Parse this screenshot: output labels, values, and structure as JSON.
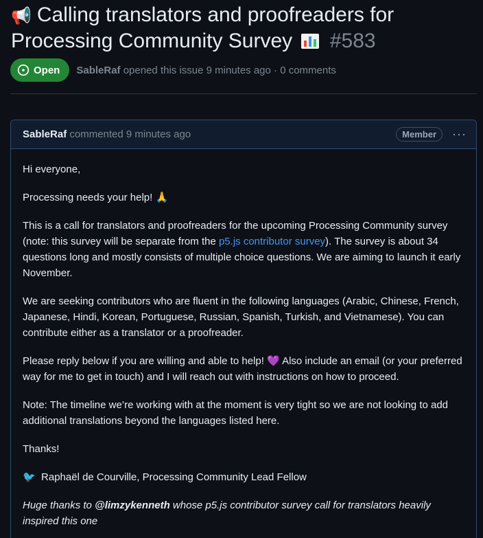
{
  "issue": {
    "megaphone_emoji": "📢",
    "title": "Calling translators and proofreaders for Processing Community Survey",
    "number": "#583",
    "status": "Open",
    "author": "SableRaf",
    "meta_rest": "opened this issue 9 minutes ago · 0 comments"
  },
  "comment": {
    "author": "SableRaf",
    "time": "commented 9 minutes ago",
    "role": "Member",
    "menu_icon": "···",
    "p1": "Hi everyone,",
    "p2": "Processing needs your help! 🙏",
    "p3_a": "This is a call for translators and proofreaders for the upcoming Processing Community survey (note: this survey will be separate from the ",
    "p3_link": "p5.js contributor survey",
    "p3_b": "). The survey is about 34 questions long and mostly consists of multiple choice questions. We are aiming to launch it early November.",
    "p4": "We are seeking contributors who are fluent in the following languages (Arabic, Chinese, French, Japanese, Hindi, Korean, Portuguese, Russian, Spanish, Turkish, and Vietnamese). You can contribute either as a translator or a proofreader.",
    "p5_a": "Please reply below if you are willing and able to help! ",
    "p5_heart": "💜",
    "p5_b": " Also include an email (or your preferred way for me to get in touch) and I will reach out with instructions on how to proceed.",
    "p6": "Note: The timeline we’re working with at the moment is very tight so we are not looking to add additional translations beyond the languages listed here.",
    "p7": "Thanks!",
    "sig_emoji": "🐦",
    "signature": "Raphaël de Courville, Processing Community Lead Fellow",
    "thanks_a": "Huge thanks to ",
    "thanks_user": "@limzykenneth",
    "thanks_b": " whose p5.js contributor survey call for translators heavily inspired this one"
  },
  "colors": {
    "open": "#238636",
    "link": "#4493f8",
    "background": "#0d1117"
  }
}
